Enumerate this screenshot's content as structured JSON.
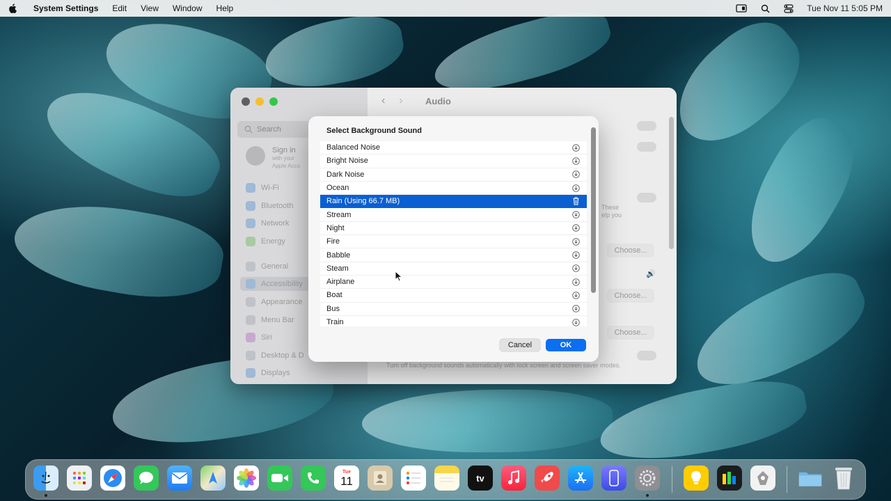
{
  "menubar": {
    "app_name": "System Settings",
    "items": [
      "Edit",
      "View",
      "Window",
      "Help"
    ],
    "datetime": "Tue Nov 11  5:05 PM"
  },
  "settings_window": {
    "title": "Audio",
    "search_placeholder": "Search",
    "signin": {
      "title": "Sign in",
      "sub1": "with your",
      "sub2": "Apple Acco"
    },
    "sidebar_items": [
      "Wi-Fi",
      "Bluetooth",
      "Network",
      "Energy",
      "General",
      "Accessibility",
      "Appearance",
      "Menu Bar",
      "Siri",
      "Desktop & D",
      "Displays"
    ],
    "choose_label": "Choose...",
    "partial_text_1": "These",
    "partial_text_2": "elp you",
    "footer_text": "Turn off background sounds automatically with lock screen and screen saver modes."
  },
  "dialog": {
    "title": "Select Background Sound",
    "sounds": [
      {
        "name": "Balanced Noise",
        "action": "download-icon"
      },
      {
        "name": "Bright Noise",
        "action": "download-icon"
      },
      {
        "name": "Dark Noise",
        "action": "download-icon"
      },
      {
        "name": "Ocean",
        "action": "download-icon"
      },
      {
        "name": "Rain (Using 66.7 MB)",
        "action": "trash-icon",
        "selected": true
      },
      {
        "name": "Stream",
        "action": "download-icon"
      },
      {
        "name": "Night",
        "action": "download-icon"
      },
      {
        "name": "Fire",
        "action": "download-icon"
      },
      {
        "name": "Babble",
        "action": "download-icon"
      },
      {
        "name": "Steam",
        "action": "download-icon"
      },
      {
        "name": "Airplane",
        "action": "download-icon"
      },
      {
        "name": "Boat",
        "action": "download-icon"
      },
      {
        "name": "Bus",
        "action": "download-icon"
      },
      {
        "name": "Train",
        "action": "download-icon"
      }
    ],
    "cancel_label": "Cancel",
    "ok_label": "OK"
  },
  "dock": {
    "calendar_month": "Tue",
    "calendar_day": "11",
    "tv_label": "tv"
  },
  "colors": {
    "accent": "#0a6ff0",
    "selection": "#0a60d2"
  }
}
